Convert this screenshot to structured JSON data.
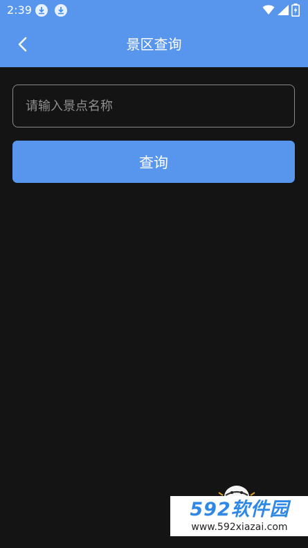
{
  "status_bar": {
    "time": "2:39",
    "icons": [
      "download-icon",
      "download-icon",
      "wifi-icon",
      "signal-icon",
      "battery-charging-icon"
    ]
  },
  "header": {
    "title": "景区查询",
    "back_icon": "chevron-left-icon"
  },
  "search": {
    "placeholder": "请输入景点名称",
    "value": ""
  },
  "query_button": {
    "label": "查询"
  },
  "watermark": {
    "brand": "592软件园",
    "url": "www.592xiazai.com"
  },
  "colors": {
    "accent": "#5896ee",
    "background": "#141414",
    "watermark_blue": "#2f88e6"
  }
}
